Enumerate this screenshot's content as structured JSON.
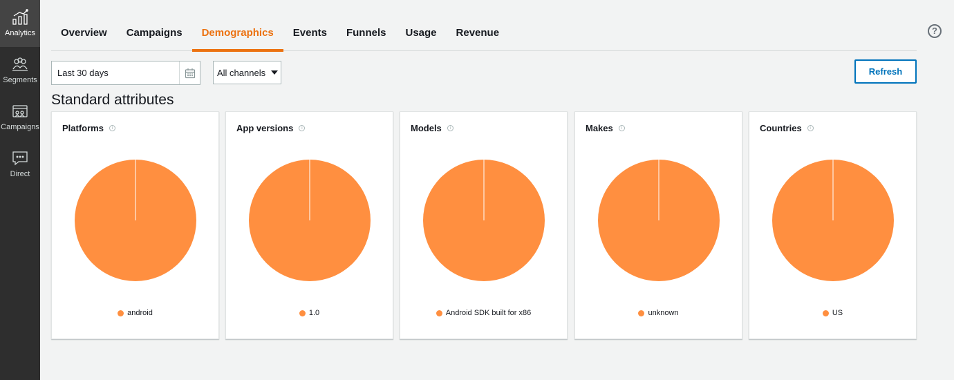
{
  "sidebar": {
    "items": [
      {
        "label": "Analytics",
        "icon": "analytics-icon",
        "active": true
      },
      {
        "label": "Segments",
        "icon": "segments-icon",
        "active": false
      },
      {
        "label": "Campaigns",
        "icon": "campaigns-icon",
        "active": false
      },
      {
        "label": "Direct",
        "icon": "direct-message-icon",
        "active": false
      }
    ]
  },
  "tabs": [
    {
      "label": "Overview"
    },
    {
      "label": "Campaigns"
    },
    {
      "label": "Demographics",
      "active": true
    },
    {
      "label": "Events"
    },
    {
      "label": "Funnels"
    },
    {
      "label": "Usage"
    },
    {
      "label": "Revenue"
    }
  ],
  "help": {
    "label": "?"
  },
  "controls": {
    "date_range": "Last 30 days",
    "channel": "All channels",
    "refresh_label": "Refresh"
  },
  "section_title": "Standard attributes",
  "colors": {
    "accent": "#ec7211",
    "slice": "#ff8f40",
    "link": "#0073bb"
  },
  "cards": [
    {
      "title": "Platforms",
      "legend": "android"
    },
    {
      "title": "App versions",
      "legend": "1.0"
    },
    {
      "title": "Models",
      "legend": "Android SDK built for x86"
    },
    {
      "title": "Makes",
      "legend": "unknown"
    },
    {
      "title": "Countries",
      "legend": "US"
    }
  ],
  "chart_data": [
    {
      "type": "pie",
      "title": "Platforms",
      "categories": [
        "android"
      ],
      "values": [
        100
      ]
    },
    {
      "type": "pie",
      "title": "App versions",
      "categories": [
        "1.0"
      ],
      "values": [
        100
      ]
    },
    {
      "type": "pie",
      "title": "Models",
      "categories": [
        "Android SDK built for x86"
      ],
      "values": [
        100
      ]
    },
    {
      "type": "pie",
      "title": "Makes",
      "categories": [
        "unknown"
      ],
      "values": [
        100
      ]
    },
    {
      "type": "pie",
      "title": "Countries",
      "categories": [
        "US"
      ],
      "values": [
        100
      ]
    }
  ]
}
